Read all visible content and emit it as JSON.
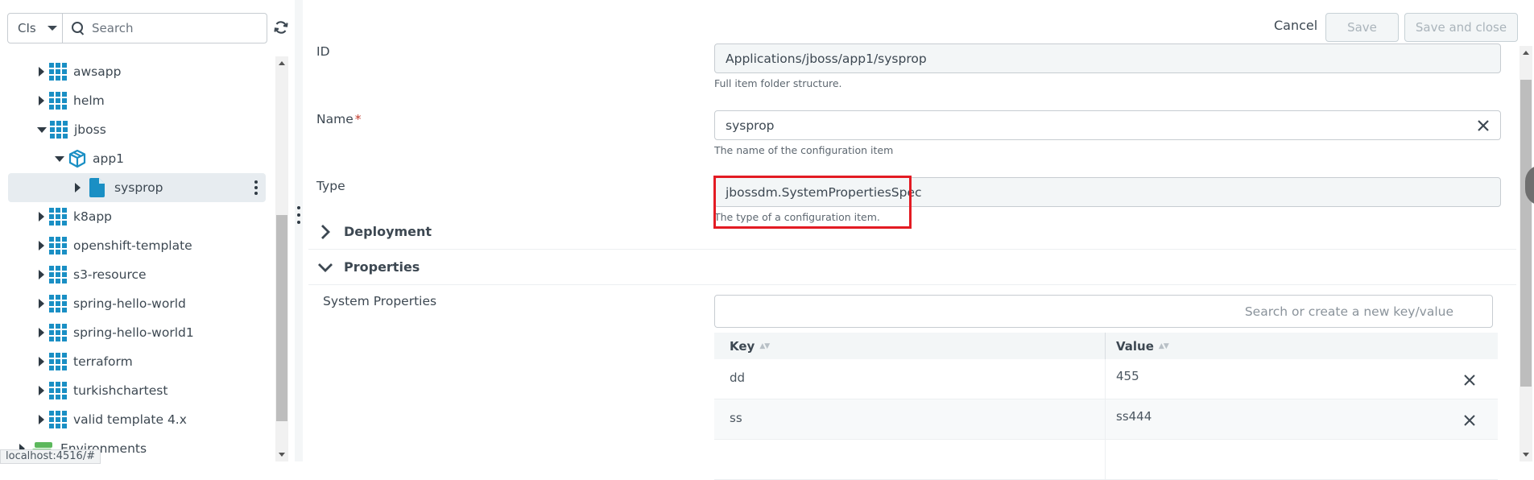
{
  "left_panel": {
    "filter_select": "CIs",
    "search_placeholder": "Search",
    "tree": [
      {
        "label": "awsapp",
        "icon": "grid-icon",
        "expanded": false,
        "level": 1
      },
      {
        "label": "helm",
        "icon": "grid-icon",
        "expanded": false,
        "level": 1
      },
      {
        "label": "jboss",
        "icon": "grid-icon",
        "expanded": true,
        "level": 1
      },
      {
        "label": "app1",
        "icon": "package-icon",
        "expanded": true,
        "level": 2
      },
      {
        "label": "sysprop",
        "icon": "file-icon",
        "expanded": false,
        "level": 3,
        "selected": true
      },
      {
        "label": "k8app",
        "icon": "grid-icon",
        "expanded": false,
        "level": 1
      },
      {
        "label": "openshift-template",
        "icon": "grid-icon",
        "expanded": false,
        "level": 1
      },
      {
        "label": "s3-resource",
        "icon": "grid-icon",
        "expanded": false,
        "level": 1
      },
      {
        "label": "spring-hello-world",
        "icon": "grid-icon",
        "expanded": false,
        "level": 1
      },
      {
        "label": "spring-hello-world1",
        "icon": "grid-icon",
        "expanded": false,
        "level": 1
      },
      {
        "label": "terraform",
        "icon": "grid-icon",
        "expanded": false,
        "level": 1
      },
      {
        "label": "turkishchartest",
        "icon": "grid-icon",
        "expanded": false,
        "level": 1
      },
      {
        "label": "valid template 4.x",
        "icon": "grid-icon",
        "expanded": false,
        "level": 1
      },
      {
        "label": "Environments",
        "icon": "environments-icon",
        "expanded": false,
        "level": 0
      }
    ],
    "status_url": "localhost:4516/#"
  },
  "toolbar": {
    "cancel_label": "Cancel",
    "save_label": "Save",
    "save_close_label": "Save and close"
  },
  "form": {
    "id": {
      "label": "ID",
      "value": "Applications/jboss/app1/sysprop",
      "help": "Full item folder structure."
    },
    "name": {
      "label": "Name",
      "required_mark": "*",
      "value": "sysprop",
      "help": "The name of the configuration item"
    },
    "type": {
      "label": "Type",
      "value": "jbossdm.SystemPropertiesSpec",
      "help": "The type of a configuration item."
    }
  },
  "sections": {
    "deployment": {
      "label": "Deployment",
      "expanded": false
    },
    "properties": {
      "label": "Properties",
      "expanded": true
    }
  },
  "system_properties": {
    "label": "System Properties",
    "search_placeholder": "Search or create a new key/value",
    "columns": {
      "key": "Key",
      "value": "Value"
    },
    "rows": [
      {
        "key": "dd",
        "value": "455"
      },
      {
        "key": "ss",
        "value": "ss444"
      }
    ]
  },
  "colors": {
    "accent": "#1a8fc4",
    "highlight": "#e31b23",
    "selected_row": "#e7ecf0"
  }
}
